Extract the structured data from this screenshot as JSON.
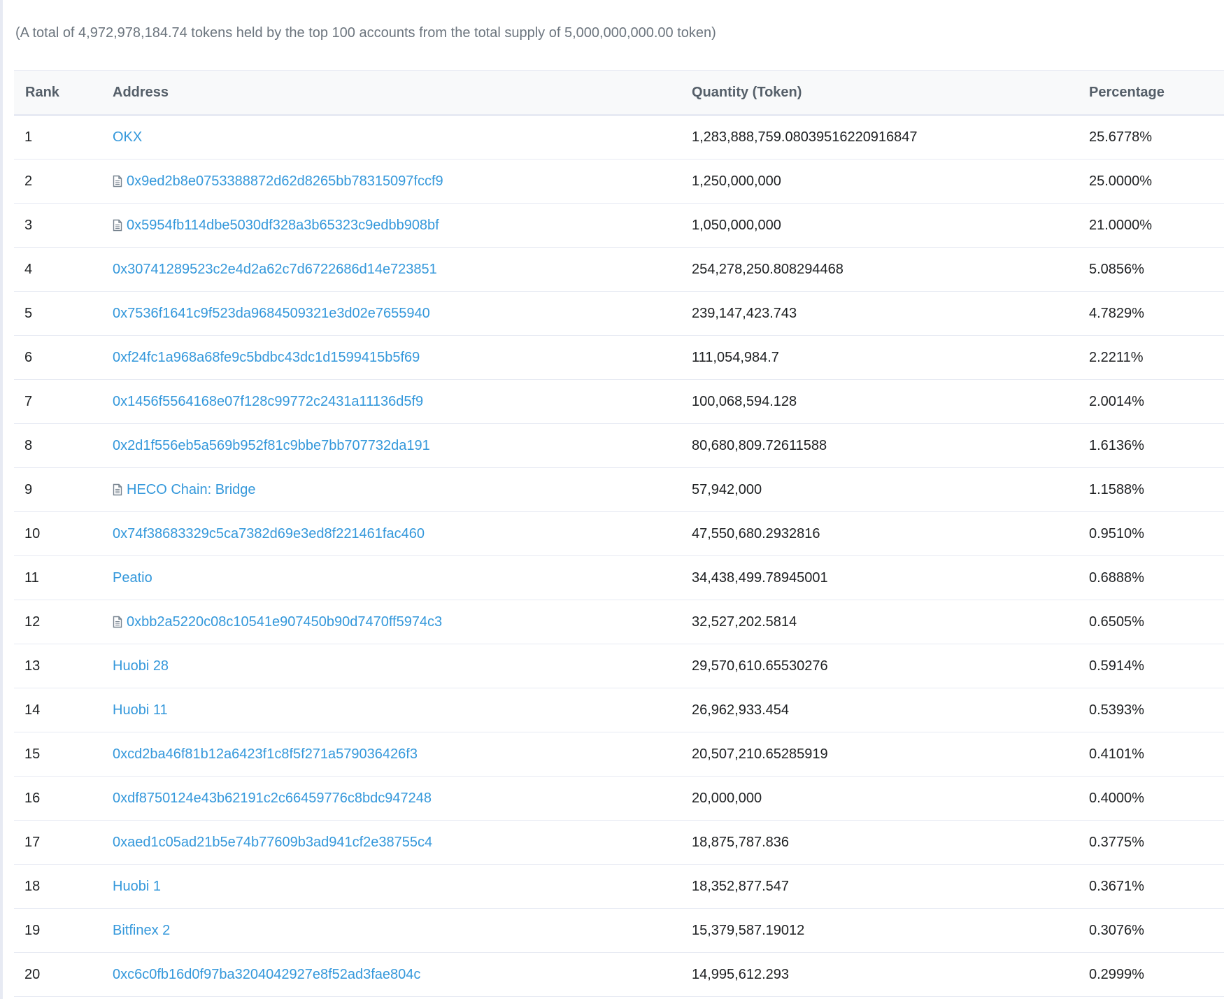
{
  "summary_text": "(A total of 4,972,978,184.74 tokens held by the top 100 accounts from the total supply of 5,000,000,000.00 token)",
  "table": {
    "headers": {
      "rank": "Rank",
      "address": "Address",
      "quantity": "Quantity (Token)",
      "percentage": "Percentage"
    },
    "rows": [
      {
        "rank": "1",
        "address": "OKX",
        "is_contract": false,
        "quantity": "1,283,888,759.08039516220916847",
        "percentage": "25.6778%"
      },
      {
        "rank": "2",
        "address": "0x9ed2b8e0753388872d62d8265bb78315097fccf9",
        "is_contract": true,
        "quantity": "1,250,000,000",
        "percentage": "25.0000%"
      },
      {
        "rank": "3",
        "address": "0x5954fb114dbe5030df328a3b65323c9edbb908bf",
        "is_contract": true,
        "quantity": "1,050,000,000",
        "percentage": "21.0000%"
      },
      {
        "rank": "4",
        "address": "0x30741289523c2e4d2a62c7d6722686d14e723851",
        "is_contract": false,
        "quantity": "254,278,250.808294468",
        "percentage": "5.0856%"
      },
      {
        "rank": "5",
        "address": "0x7536f1641c9f523da9684509321e3d02e7655940",
        "is_contract": false,
        "quantity": "239,147,423.743",
        "percentage": "4.7829%"
      },
      {
        "rank": "6",
        "address": "0xf24fc1a968a68fe9c5bdbc43dc1d1599415b5f69",
        "is_contract": false,
        "quantity": "111,054,984.7",
        "percentage": "2.2211%"
      },
      {
        "rank": "7",
        "address": "0x1456f5564168e07f128c99772c2431a11136d5f9",
        "is_contract": false,
        "quantity": "100,068,594.128",
        "percentage": "2.0014%"
      },
      {
        "rank": "8",
        "address": "0x2d1f556eb5a569b952f81c9bbe7bb707732da191",
        "is_contract": false,
        "quantity": "80,680,809.72611588",
        "percentage": "1.6136%"
      },
      {
        "rank": "9",
        "address": "HECO Chain: Bridge",
        "is_contract": true,
        "quantity": "57,942,000",
        "percentage": "1.1588%"
      },
      {
        "rank": "10",
        "address": "0x74f38683329c5ca7382d69e3ed8f221461fac460",
        "is_contract": false,
        "quantity": "47,550,680.2932816",
        "percentage": "0.9510%"
      },
      {
        "rank": "11",
        "address": "Peatio",
        "is_contract": false,
        "quantity": "34,438,499.78945001",
        "percentage": "0.6888%"
      },
      {
        "rank": "12",
        "address": "0xbb2a5220c08c10541e907450b90d7470ff5974c3",
        "is_contract": true,
        "quantity": "32,527,202.5814",
        "percentage": "0.6505%"
      },
      {
        "rank": "13",
        "address": "Huobi 28",
        "is_contract": false,
        "quantity": "29,570,610.65530276",
        "percentage": "0.5914%"
      },
      {
        "rank": "14",
        "address": "Huobi 11",
        "is_contract": false,
        "quantity": "26,962,933.454",
        "percentage": "0.5393%"
      },
      {
        "rank": "15",
        "address": "0xcd2ba46f81b12a6423f1c8f5f271a579036426f3",
        "is_contract": false,
        "quantity": "20,507,210.65285919",
        "percentage": "0.4101%"
      },
      {
        "rank": "16",
        "address": "0xdf8750124e43b62191c2c66459776c8bdc947248",
        "is_contract": false,
        "quantity": "20,000,000",
        "percentage": "0.4000%"
      },
      {
        "rank": "17",
        "address": "0xaed1c05ad21b5e74b77609b3ad941cf2e38755c4",
        "is_contract": false,
        "quantity": "18,875,787.836",
        "percentage": "0.3775%"
      },
      {
        "rank": "18",
        "address": "Huobi 1",
        "is_contract": false,
        "quantity": "18,352,877.547",
        "percentage": "0.3671%"
      },
      {
        "rank": "19",
        "address": "Bitfinex 2",
        "is_contract": false,
        "quantity": "15,379,587.19012",
        "percentage": "0.3076%"
      },
      {
        "rank": "20",
        "address": "0xc6c0fb16d0f97ba3204042927e8f52ad3fae804c",
        "is_contract": false,
        "quantity": "14,995,612.293",
        "percentage": "0.2999%"
      }
    ]
  },
  "colors": {
    "link": "#3498db",
    "header_text": "#555f69",
    "muted_text": "#6c757e",
    "border": "#e7eaf3",
    "header_bg": "#f8f9fa"
  },
  "icons": {
    "contract": "file-text-icon"
  }
}
